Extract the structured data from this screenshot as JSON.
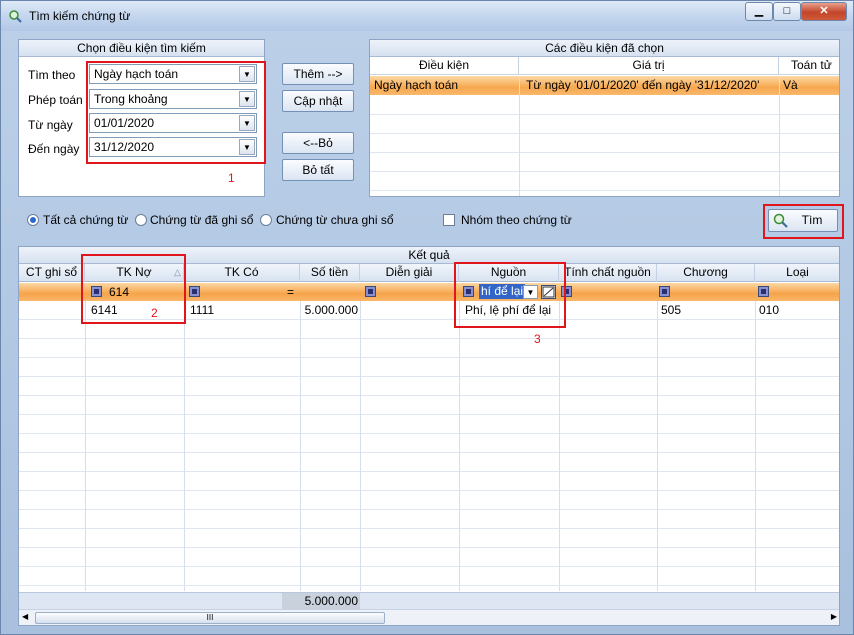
{
  "window": {
    "title": "Tìm kiếm chứng từ",
    "minimize": "▁",
    "maximize": "□",
    "close": "✕"
  },
  "criteria": {
    "header": "Chọn điều kiện tìm kiếm",
    "rows": [
      {
        "label": "Tìm theo",
        "value": "Ngày hạch toán"
      },
      {
        "label": "Phép toán",
        "value": "Trong khoảng"
      },
      {
        "label": "Từ ngày",
        "value": "01/01/2020"
      },
      {
        "label": "Đến ngày",
        "value": "31/12/2020"
      }
    ],
    "marker": "1"
  },
  "buttons": {
    "add": "Thêm -->",
    "update": "Cập nhật",
    "remove": "<--Bỏ",
    "remove_all": "Bỏ tất",
    "search": "Tìm"
  },
  "selected": {
    "header": "Các điều kiện đã chọn",
    "columns": [
      "Điều kiện",
      "Giá trị",
      "Toán tử"
    ],
    "rows": [
      {
        "condition": "Ngày hạch toán",
        "value": "Từ ngày '01/01/2020' đến ngày '31/12/2020'",
        "operator": "Và"
      }
    ]
  },
  "filter": {
    "all": "Tất cả chứng từ",
    "posted": "Chứng từ đã ghi sổ",
    "unposted": "Chứng từ chưa ghi sổ",
    "group": "Nhóm theo chứng từ"
  },
  "results": {
    "header": "Kết quả",
    "columns": [
      "CT ghi sổ",
      "TK Nợ",
      "TK Có",
      "Số tiền",
      "Diễn giải",
      "Nguồn",
      "Tính chất nguồn",
      "Chương",
      "Loại"
    ],
    "filter_tk_no": "614",
    "filter_amount_op": "=",
    "filter_source": "hí để lại",
    "row": {
      "tk_no": "6141",
      "tk_co": "1111",
      "amount": "5.000.000",
      "source": "Phí, lệ phí để lại",
      "chapter": "505",
      "type": "010"
    },
    "total": "5.000.000",
    "marker_tk": "2",
    "marker_source": "3",
    "scroll_thumb": "III"
  }
}
